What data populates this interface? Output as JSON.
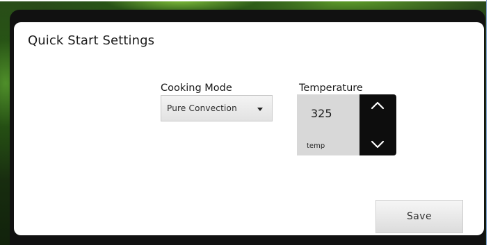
{
  "dialog": {
    "title": "Quick Start Settings"
  },
  "cooking_mode": {
    "label": "Cooking Mode",
    "selected": "Pure Convection"
  },
  "temperature": {
    "label": "Temperature",
    "value": "325",
    "unit_label": "temp"
  },
  "actions": {
    "save_label": "Save"
  },
  "icons": {
    "dropdown": "chevron-down-icon",
    "increase": "chevron-up-icon",
    "decrease": "chevron-down-icon"
  },
  "colors": {
    "dialog_background": "#ffffff",
    "stepper_background": "#0d0d0d",
    "temperature_box": "#d8d8d8"
  }
}
